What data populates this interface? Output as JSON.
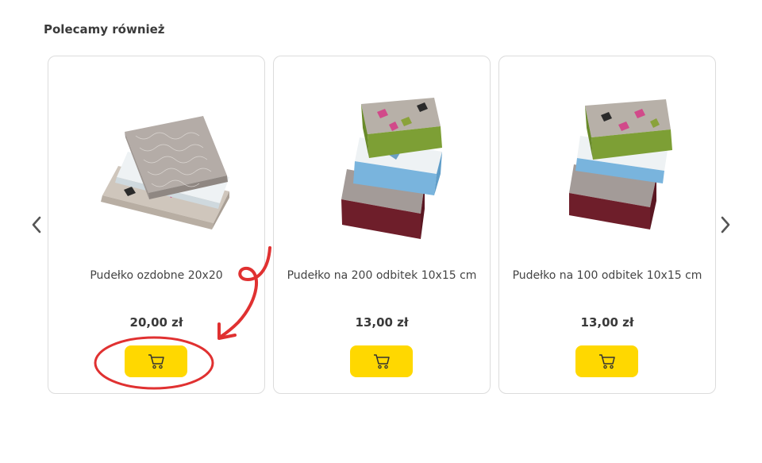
{
  "section": {
    "title": "Polecamy również"
  },
  "nav": {
    "prev_icon": "chevron-left-icon",
    "next_icon": "chevron-right-icon"
  },
  "products": [
    {
      "name": "Pudełko ozdobne 20x20",
      "price": "20,00 zł"
    },
    {
      "name": "Pudełko na 200 odbitek 10x15 cm",
      "price": "13,00 zł"
    },
    {
      "name": "Pudełko na 100 odbitek 10x15 cm",
      "price": "13,00 zł"
    }
  ],
  "colors": {
    "cart_button": "#ffd800",
    "annotation": "#e03131",
    "card_border": "#dcdcdc"
  }
}
